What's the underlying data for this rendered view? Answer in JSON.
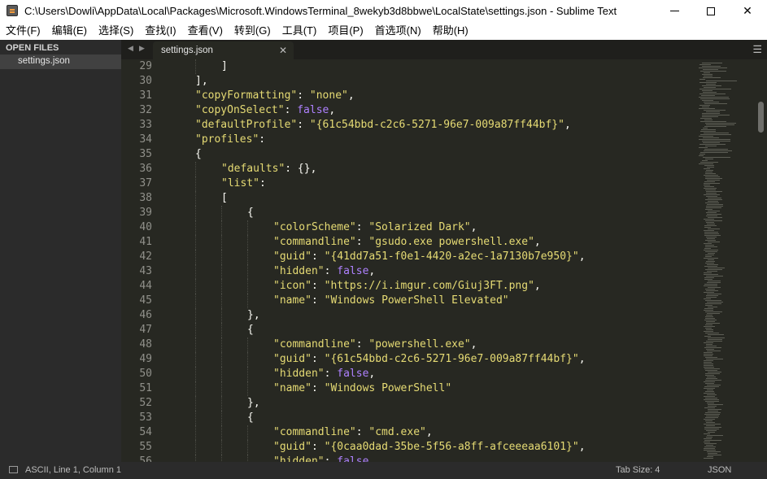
{
  "window": {
    "title": "C:\\Users\\Dowli\\AppData\\Local\\Packages\\Microsoft.WindowsTerminal_8wekyb3d8bbwe\\LocalState\\settings.json - Sublime Text",
    "minimize": "",
    "maximize": "",
    "close": "✕"
  },
  "menu": [
    "文件(F)",
    "编辑(E)",
    "选择(S)",
    "查找(I)",
    "查看(V)",
    "转到(G)",
    "工具(T)",
    "项目(P)",
    "首选项(N)",
    "帮助(H)"
  ],
  "sidebar": {
    "header": "OPEN FILES",
    "files": [
      "settings.json"
    ]
  },
  "tabs": {
    "prev": "◀",
    "next": "▶",
    "active": "settings.json",
    "close": "✕",
    "menu": "☰"
  },
  "editor": {
    "lines": [
      {
        "n": "29",
        "indent": 2,
        "tokens": [
          [
            "k",
            "]"
          ]
        ]
      },
      {
        "n": "30",
        "indent": 1,
        "tokens": [
          [
            "k",
            "],"
          ]
        ]
      },
      {
        "n": "31",
        "indent": 1,
        "tokens": [
          [
            "s",
            "\"copyFormatting\""
          ],
          [
            "k",
            ": "
          ],
          [
            "s",
            "\"none\""
          ],
          [
            "k",
            ","
          ]
        ]
      },
      {
        "n": "32",
        "indent": 1,
        "tokens": [
          [
            "s",
            "\"copyOnSelect\""
          ],
          [
            "k",
            ": "
          ],
          [
            "b",
            "false"
          ],
          [
            "k",
            ","
          ]
        ]
      },
      {
        "n": "33",
        "indent": 1,
        "tokens": [
          [
            "s",
            "\"defaultProfile\""
          ],
          [
            "k",
            ": "
          ],
          [
            "s",
            "\"{61c54bbd-c2c6-5271-96e7-009a87ff44bf}\""
          ],
          [
            "k",
            ","
          ]
        ]
      },
      {
        "n": "34",
        "indent": 1,
        "tokens": [
          [
            "s",
            "\"profiles\""
          ],
          [
            "k",
            ":"
          ]
        ]
      },
      {
        "n": "35",
        "indent": 1,
        "tokens": [
          [
            "k",
            "{"
          ]
        ]
      },
      {
        "n": "36",
        "indent": 2,
        "tokens": [
          [
            "s",
            "\"defaults\""
          ],
          [
            "k",
            ": {},"
          ]
        ]
      },
      {
        "n": "37",
        "indent": 2,
        "tokens": [
          [
            "s",
            "\"list\""
          ],
          [
            "k",
            ":"
          ]
        ]
      },
      {
        "n": "38",
        "indent": 2,
        "tokens": [
          [
            "k",
            "["
          ]
        ]
      },
      {
        "n": "39",
        "indent": 3,
        "tokens": [
          [
            "k",
            "{"
          ]
        ]
      },
      {
        "n": "40",
        "indent": 4,
        "tokens": [
          [
            "s",
            "\"colorScheme\""
          ],
          [
            "k",
            ": "
          ],
          [
            "s",
            "\"Solarized Dark\""
          ],
          [
            "k",
            ","
          ]
        ]
      },
      {
        "n": "41",
        "indent": 4,
        "tokens": [
          [
            "s",
            "\"commandline\""
          ],
          [
            "k",
            ": "
          ],
          [
            "s",
            "\"gsudo.exe powershell.exe\""
          ],
          [
            "k",
            ","
          ]
        ]
      },
      {
        "n": "42",
        "indent": 4,
        "tokens": [
          [
            "s",
            "\"guid\""
          ],
          [
            "k",
            ": "
          ],
          [
            "s",
            "\"{41dd7a51-f0e1-4420-a2ec-1a7130b7e950}\""
          ],
          [
            "k",
            ","
          ]
        ]
      },
      {
        "n": "43",
        "indent": 4,
        "tokens": [
          [
            "s",
            "\"hidden\""
          ],
          [
            "k",
            ": "
          ],
          [
            "b",
            "false"
          ],
          [
            "k",
            ","
          ]
        ]
      },
      {
        "n": "44",
        "indent": 4,
        "tokens": [
          [
            "s",
            "\"icon\""
          ],
          [
            "k",
            ": "
          ],
          [
            "s",
            "\"https://i.imgur.com/Giuj3FT.png\""
          ],
          [
            "k",
            ","
          ]
        ]
      },
      {
        "n": "45",
        "indent": 4,
        "tokens": [
          [
            "s",
            "\"name\""
          ],
          [
            "k",
            ": "
          ],
          [
            "s",
            "\"Windows PowerShell Elevated\""
          ]
        ]
      },
      {
        "n": "46",
        "indent": 3,
        "tokens": [
          [
            "k",
            "},"
          ]
        ]
      },
      {
        "n": "47",
        "indent": 3,
        "tokens": [
          [
            "k",
            "{"
          ]
        ]
      },
      {
        "n": "48",
        "indent": 4,
        "tokens": [
          [
            "s",
            "\"commandline\""
          ],
          [
            "k",
            ": "
          ],
          [
            "s",
            "\"powershell.exe\""
          ],
          [
            "k",
            ","
          ]
        ]
      },
      {
        "n": "49",
        "indent": 4,
        "tokens": [
          [
            "s",
            "\"guid\""
          ],
          [
            "k",
            ": "
          ],
          [
            "s",
            "\"{61c54bbd-c2c6-5271-96e7-009a87ff44bf}\""
          ],
          [
            "k",
            ","
          ]
        ]
      },
      {
        "n": "50",
        "indent": 4,
        "tokens": [
          [
            "s",
            "\"hidden\""
          ],
          [
            "k",
            ": "
          ],
          [
            "b",
            "false"
          ],
          [
            "k",
            ","
          ]
        ]
      },
      {
        "n": "51",
        "indent": 4,
        "tokens": [
          [
            "s",
            "\"name\""
          ],
          [
            "k",
            ": "
          ],
          [
            "s",
            "\"Windows PowerShell\""
          ]
        ]
      },
      {
        "n": "52",
        "indent": 3,
        "tokens": [
          [
            "k",
            "},"
          ]
        ]
      },
      {
        "n": "53",
        "indent": 3,
        "tokens": [
          [
            "k",
            "{"
          ]
        ]
      },
      {
        "n": "54",
        "indent": 4,
        "tokens": [
          [
            "s",
            "\"commandline\""
          ],
          [
            "k",
            ": "
          ],
          [
            "s",
            "\"cmd.exe\""
          ],
          [
            "k",
            ","
          ]
        ]
      },
      {
        "n": "55",
        "indent": 4,
        "tokens": [
          [
            "s",
            "\"guid\""
          ],
          [
            "k",
            ": "
          ],
          [
            "s",
            "\"{0caa0dad-35be-5f56-a8ff-afceeeaa6101}\""
          ],
          [
            "k",
            ","
          ]
        ]
      },
      {
        "n": "56",
        "indent": 4,
        "tokens": [
          [
            "s",
            "\"hidden\""
          ],
          [
            "k",
            ": "
          ],
          [
            "b",
            "false"
          ]
        ]
      }
    ]
  },
  "status": {
    "position": "ASCII, Line 1, Column 1",
    "tab_size": "Tab Size: 4",
    "syntax": "JSON"
  },
  "colors": {
    "editor_bg": "#272822",
    "string": "#e6db74",
    "boolean": "#ae81ff",
    "text": "#f8f8f2"
  },
  "icons": [
    "app-icon",
    "minimize-icon",
    "maximize-icon",
    "close-icon",
    "tab-prev-icon",
    "tab-next-icon",
    "tab-close-icon",
    "tab-menu-icon",
    "panel-icon"
  ]
}
